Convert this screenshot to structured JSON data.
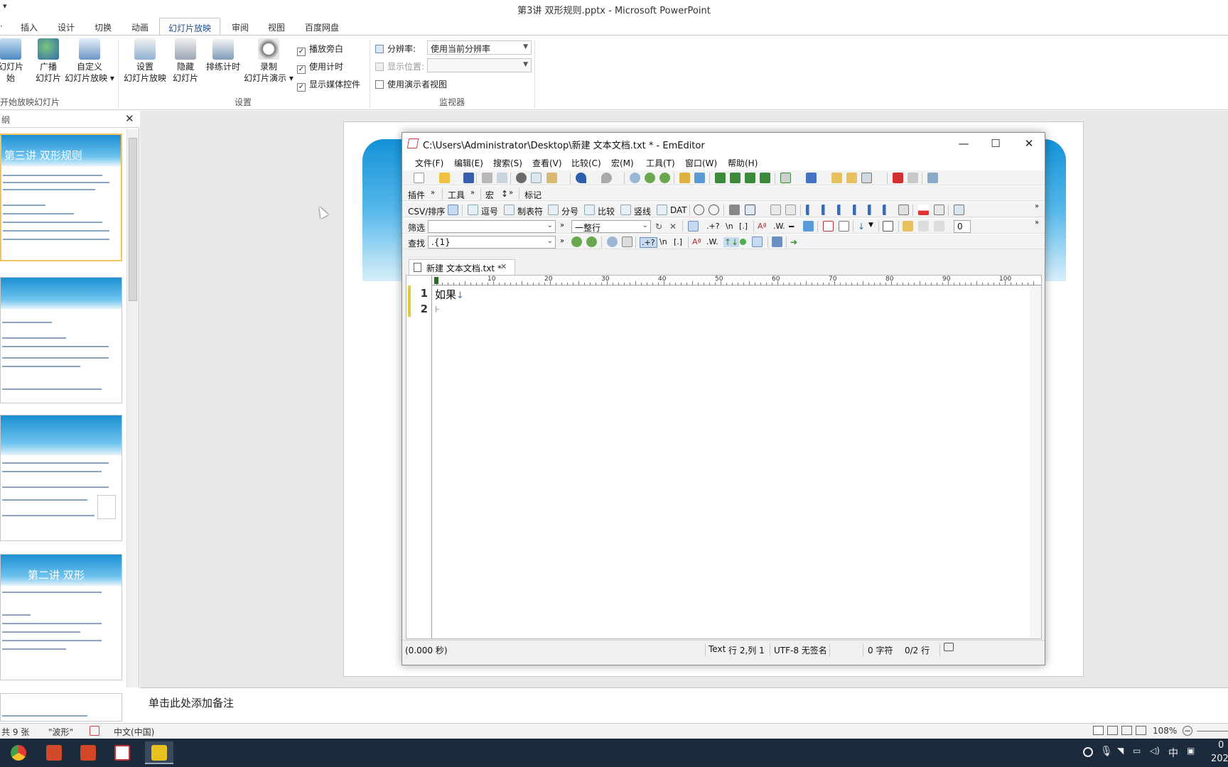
{
  "powerpoint": {
    "qat_glyph": "▾",
    "title": "第3讲 双形规则.pptx  -  Microsoft PowerPoint",
    "tabs": [
      "插入",
      "设计",
      "切换",
      "动画",
      "幻灯片放映",
      "审阅",
      "视图",
      "百度网盘"
    ],
    "active_tab": "幻灯片放映",
    "ribbon": {
      "from_start_label_1": "幻灯片",
      "from_start_label_2": "始",
      "broadcast_label_1": "广播",
      "broadcast_label_2": "幻灯片",
      "custom_label_1": "自定义",
      "custom_label_2": "幻灯片放映",
      "setup_label_1": "设置",
      "setup_label_2": "幻灯片放映",
      "hide_label_1": "隐藏",
      "hide_label_2": "幻灯片",
      "rehearse_label": "排练计时",
      "record_label_1": "录制",
      "record_label_2": "幻灯片演示",
      "group_start": "开始放映幻灯片",
      "group_setup": "设置",
      "group_monitor": "监视器",
      "chk_narration": "播放旁白",
      "chk_timing": "使用计时",
      "chk_media": "显示媒体控件",
      "resolution_label": "分辨率:",
      "resolution_value": "使用当前分辨率",
      "display_label": "显示位置:",
      "presenter_view": "使用演示者视图"
    },
    "slides_pane_header": "纲",
    "slide_thumbnails": [
      {
        "title": "第三讲 双形规则"
      },
      {
        "title": ""
      },
      {
        "title": ""
      },
      {
        "title": "第二讲 双形"
      },
      {
        "title": ""
      }
    ],
    "notes_placeholder": "单击此处添加备注",
    "status": {
      "slide_count": "共 9 张",
      "theme": "\"波形\"",
      "language": "中文(中国)",
      "zoom": "108%"
    },
    "taskbar_ime": "中",
    "clock_fragment_1": "0",
    "clock_fragment_2": "202"
  },
  "emeditor": {
    "title": "C:\\Users\\Administrator\\Desktop\\新建 文本文档.txt * - EmEditor",
    "window_controls": {
      "minimize": "—",
      "maximize": "☐",
      "close": "✕"
    },
    "menus": [
      "文件(F)",
      "编辑(E)",
      "搜索(S)",
      "查看(V)",
      "比较(C)",
      "宏(M)",
      "工具(T)",
      "窗口(W)",
      "帮助(H)"
    ],
    "toolbar2": {
      "plugins": "插件",
      "tools": "工具",
      "macro": "宏",
      "macro_extra": "↕",
      "markers": "标记"
    },
    "csv_toolbar": {
      "csv": "CSV/排序",
      "comma": "逗号",
      "tab": "制表符",
      "semicolon": "分号",
      "compare": "比较",
      "vertical": "竖线",
      "dat": "DAT"
    },
    "filter": {
      "label": "筛选",
      "value": "",
      "mode": "一整行",
      "count": "0",
      "nl": "\\n",
      "brackets": "[.]",
      "regex": ".+?"
    },
    "find": {
      "label": "查找",
      "value": ".{1}",
      "nl": "\\n",
      "brackets": "[.]",
      "regex": ".+?"
    },
    "doc_tab": "新建 文本文档.txt *",
    "ruler_marks": [
      "10",
      "20",
      "30",
      "40",
      "50",
      "60",
      "70",
      "80",
      "90",
      "100"
    ],
    "lines": [
      {
        "number": "1",
        "text": "如果",
        "eol": "↓"
      },
      {
        "number": "2",
        "text": "",
        "eol": "⊦"
      }
    ],
    "status": {
      "time": "(0.000 秒)",
      "mode": "Text",
      "position": "行 2,列 1",
      "encoding": "UTF-8 无签名",
      "chars": "0 字符",
      "lines": "0/2 行"
    }
  },
  "colors": {
    "accent_blue": "#1492d8",
    "taskbar": "#1c2b3c",
    "line_marker": "#e2c842"
  }
}
